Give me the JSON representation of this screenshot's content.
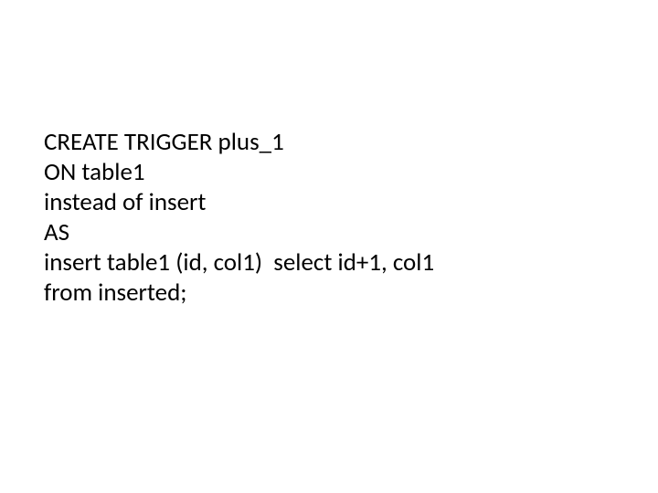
{
  "slide": {
    "lines": [
      "CREATE TRIGGER plus_1",
      "ON table1",
      "instead of insert",
      "AS",
      "insert table1 (id, col1)  select id+1, col1",
      "from inserted;"
    ]
  }
}
